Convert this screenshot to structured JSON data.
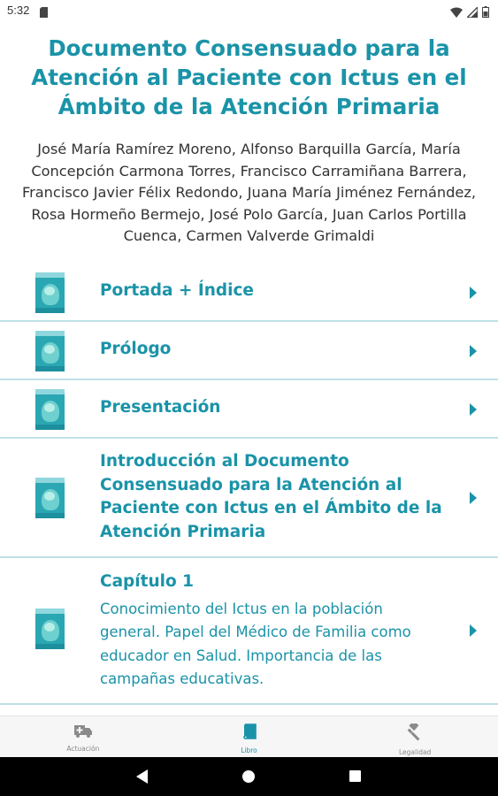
{
  "status_bar": {
    "time": "5:32",
    "icons": [
      "sd-card-icon",
      "wifi-icon",
      "signal-icon",
      "battery-icon"
    ]
  },
  "document": {
    "title": "Documento Consensuado para la Atención al Paciente con Ictus en el Ámbito de la Atención Primaria",
    "authors": "José María Ramírez Moreno, Alfonso Barquilla García, María Concepción Carmona Torres, Francisco Carramiñana Barrera, Francisco Javier Félix Redondo, Juana María Jiménez Fernández, Rosa Hormeño Bermejo, José Polo García, Juan Carlos Portilla Cuenca, Carmen Valverde Grimaldi"
  },
  "chapters": [
    {
      "title": "Portada + Índice",
      "subtitle": ""
    },
    {
      "title": "Prólogo",
      "subtitle": ""
    },
    {
      "title": "Presentación",
      "subtitle": ""
    },
    {
      "title": "Introducción al Documento Consensuado para la Atención al Paciente con Ictus en el Ámbito de la Atención Primaria",
      "subtitle": ""
    },
    {
      "title": "Capítulo 1",
      "subtitle": "Conocimiento del Ictus en la población general. Papel del Médico de Familia como educador en Salud. Importancia de las campañas educativas."
    }
  ],
  "bottom_nav": {
    "tabs": [
      {
        "label": "Actuación",
        "icon": "ambulance-icon",
        "active": false
      },
      {
        "label": "Libro",
        "icon": "book-icon",
        "active": true
      },
      {
        "label": "Legalidad",
        "icon": "gavel-icon",
        "active": false
      }
    ]
  },
  "colors": {
    "accent": "#1a93a8",
    "divider": "#bfe0e8",
    "inactive": "#888888"
  }
}
